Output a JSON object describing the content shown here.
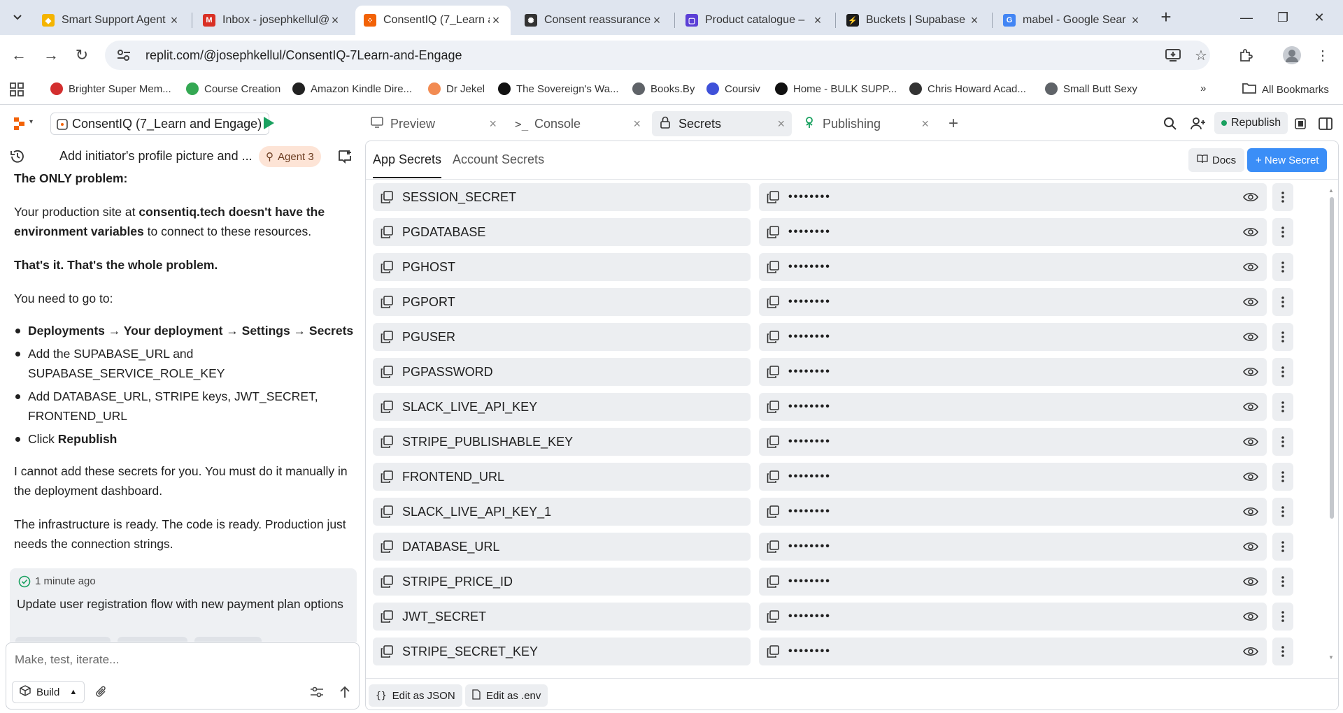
{
  "browser": {
    "tabs": [
      {
        "title": "Smart Support Agent",
        "fav_color": "#f4b400",
        "fav_glyph": "◆"
      },
      {
        "title": "Inbox - josephkellul@",
        "fav_color": "#d93025",
        "fav_glyph": "M"
      },
      {
        "title": "ConsentIQ (7_Learn a",
        "fav_color": "#f26207",
        "fav_glyph": "⁘"
      },
      {
        "title": "Consent reassurance",
        "fav_color": "#333333",
        "fav_glyph": "✺"
      },
      {
        "title": "Product catalogue –",
        "fav_color": "#5b3fd6",
        "fav_glyph": "▢"
      },
      {
        "title": "Buckets | Supabase",
        "fav_color": "#1c1c1c",
        "fav_glyph": "⚡"
      },
      {
        "title": "mabel - Google Sear",
        "fav_color": "#4285f4",
        "fav_glyph": "G"
      }
    ],
    "url": "replit.com/@josephkellul/ConsentIQ-7Learn-and-Engage",
    "bookmarks": [
      {
        "label": "Brighter Super Mem...",
        "color": "#d32f2f"
      },
      {
        "label": "Course Creation",
        "color": "#34a853"
      },
      {
        "label": "Amazon Kindle Dire...",
        "color": "#222222"
      },
      {
        "label": "Dr Jekel",
        "color": "#f28b52"
      },
      {
        "label": "The Sovereign's Wa...",
        "color": "#111111"
      },
      {
        "label": "Books.By",
        "color": "#5f6368"
      },
      {
        "label": "Coursiv",
        "color": "#3f51d9"
      },
      {
        "label": "Home - BULK SUPP...",
        "color": "#111111"
      },
      {
        "label": "Chris Howard Acad...",
        "color": "#333333"
      },
      {
        "label": "Small Butt Sexy",
        "color": "#5f6368"
      }
    ],
    "all_bookmarks": "All Bookmarks"
  },
  "app": {
    "project_name": "ConsentIQ (7_Learn and Engage)",
    "pane_tabs": [
      {
        "label": "Preview",
        "icon": "monitor-icon"
      },
      {
        "label": "Console",
        "icon": "terminal-icon"
      },
      {
        "label": "Secrets",
        "icon": "lock-icon"
      },
      {
        "label": "Publishing",
        "icon": "publish-icon"
      }
    ],
    "republish": "Republish"
  },
  "chat": {
    "title": "Add initiator's profile picture and ...",
    "agent_badge": "Agent 3",
    "heading": "The ONLY problem:",
    "p1_a": "Your production site at ",
    "p1_b": "consentiq.tech doesn't have the environment variables",
    "p1_c": " to connect to these resources.",
    "p2": "That's it. That's the whole problem.",
    "p3": "You need to go to:",
    "bullet1": "Deployments → Your deployment → Settings → Secrets",
    "bullet2": "Add the SUPABASE_URL and SUPABASE_SERVICE_ROLE_KEY",
    "bullet3": "Add DATABASE_URL, STRIPE keys, JWT_SECRET, FRONTEND_URL",
    "bullet4_a": "Click ",
    "bullet4_b": "Republish",
    "p4": "I cannot add these secrets for you. You must do it manually in the deployment dashboard.",
    "p5": "The infrastructure is ready. The code is ready. Production just needs the connection strings.",
    "checkpoint_time": "1 minute ago",
    "checkpoint_msg": "Update user registration flow with new payment plan options",
    "composer_placeholder": "Make, test, iterate...",
    "build_label": "Build"
  },
  "secrets": {
    "tab_app": "App Secrets",
    "tab_account": "Account Secrets",
    "docs": "Docs",
    "new_secret": "+ New Secret",
    "masked": "••••••••",
    "items": [
      "SESSION_SECRET",
      "PGDATABASE",
      "PGHOST",
      "PGPORT",
      "PGUSER",
      "PGPASSWORD",
      "SLACK_LIVE_API_KEY",
      "STRIPE_PUBLISHABLE_KEY",
      "FRONTEND_URL",
      "SLACK_LIVE_API_KEY_1",
      "DATABASE_URL",
      "STRIPE_PRICE_ID",
      "JWT_SECRET",
      "STRIPE_SECRET_KEY"
    ],
    "edit_json": "Edit as JSON",
    "edit_env": "Edit as .env"
  }
}
